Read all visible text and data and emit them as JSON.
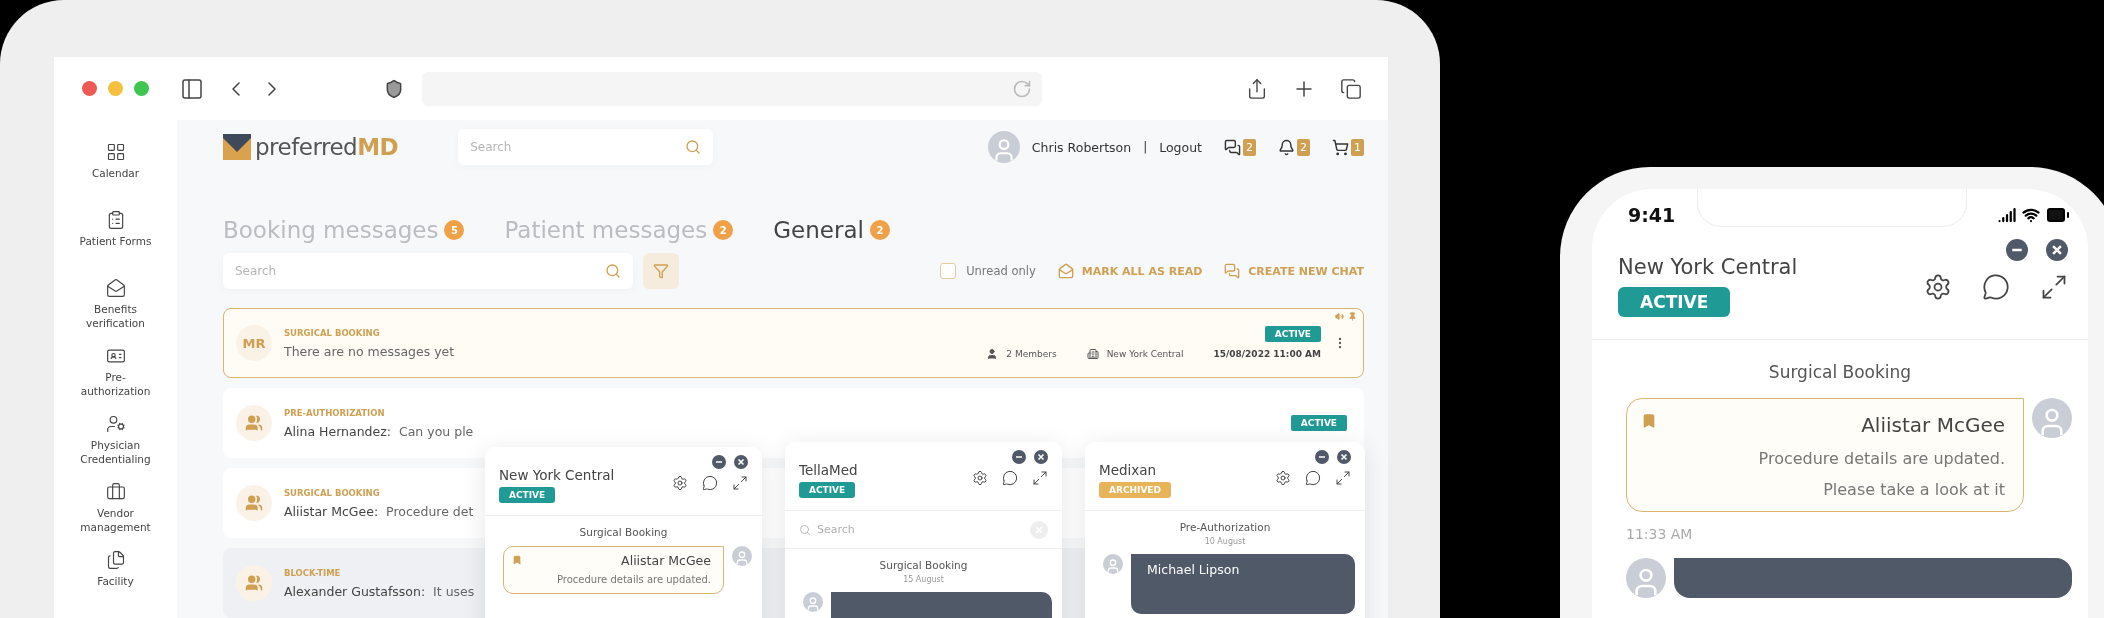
{
  "sidebar": {
    "items": [
      {
        "label": "Calendar"
      },
      {
        "label": "Patient Forms"
      },
      {
        "label": "Benefits verification"
      },
      {
        "label": "Pre-authorization"
      },
      {
        "label": "Physician Credentialing"
      },
      {
        "label": "Vendor management"
      },
      {
        "label": "Facility"
      }
    ]
  },
  "header": {
    "logo": "preferred**MD**",
    "search": {
      "placeholder": "Search"
    },
    "user": {
      "name": "Chris Robertson",
      "separator": "|",
      "logout": "Logout"
    },
    "counters": [
      {
        "count": "2"
      },
      {
        "count": "2"
      },
      {
        "count": "1"
      }
    ]
  },
  "tabs": [
    {
      "label": "Booking messages",
      "count": "5",
      "selected": false
    },
    {
      "label": "Patient messages",
      "count": "2",
      "selected": false
    },
    {
      "label": "General",
      "count": "2",
      "selected": true
    }
  ],
  "toolbar": {
    "search": {
      "placeholder": "Search"
    },
    "unread_only": {
      "label": "Unread only",
      "checked": false
    },
    "actions": [
      {
        "label": "MARK ALL AS READ"
      },
      {
        "label": "CREATE NEW CHAT"
      }
    ]
  },
  "chats": [
    {
      "category": "SURGICAL BOOKING",
      "initials": "MR",
      "message": "There are no messages yet",
      "members": "2 Members",
      "location": "New York Central",
      "date": "15/08/2022 11:00 AM",
      "status": {
        "kind": "active",
        "label": "ACTIVE"
      },
      "selected": true,
      "highlighted": false,
      "muted": true,
      "pinned": true
    },
    {
      "category": "PRE-AUTHORIZATION",
      "sender": "Alina Hernandez:",
      "message": "Can you ple",
      "status": {
        "kind": "active",
        "label": "ACTIVE"
      },
      "selected": false,
      "highlighted": false,
      "muted": false,
      "pinned": false
    },
    {
      "category": "SURGICAL BOOKING",
      "sender": "Aliistar McGee:",
      "message": "Procedure det",
      "selected": false,
      "highlighted": false,
      "muted": false,
      "pinned": false
    },
    {
      "category": "BLOCK-TIME",
      "sender": "Alexander Gustafsson:",
      "message": "It uses",
      "selected": false,
      "highlighted": true,
      "muted": false,
      "pinned": false
    }
  ],
  "popups": [
    {
      "title": "New York Central",
      "status": {
        "kind": "active",
        "label": "ACTIVE"
      },
      "section": "Surgical Booking",
      "messages": [
        {
          "kind": "highlight",
          "bookmarked": true,
          "sender": "Aliistar McGee",
          "lines": [
            "Procedure details are updated."
          ]
        }
      ]
    },
    {
      "title": "TellaMed",
      "status": {
        "kind": "active",
        "label": "ACTIVE"
      },
      "search": {
        "placeholder": "Search"
      },
      "section": "Surgical Booking",
      "date": "15 August",
      "messages": [
        {
          "kind": "dark"
        }
      ]
    },
    {
      "title": "Medixan",
      "status": {
        "kind": "archived",
        "label": "ARCHIVED"
      },
      "section": "Pre-Authorization",
      "date": "10 August",
      "messages": [
        {
          "kind": "dark",
          "sender": "Michael Lipson"
        }
      ]
    }
  ],
  "phone": {
    "time": "9:41",
    "chat": {
      "title": "New York Central",
      "status": {
        "kind": "active",
        "label": "ACTIVE"
      },
      "section": "Surgical Booking",
      "messages": [
        {
          "kind": "highlight",
          "bookmarked": true,
          "sender": "Aliistar McGee",
          "lines": [
            "Procedure details are updated.",
            "Please take a look at it"
          ],
          "time": "11:33 AM"
        },
        {
          "kind": "dark"
        }
      ]
    }
  }
}
